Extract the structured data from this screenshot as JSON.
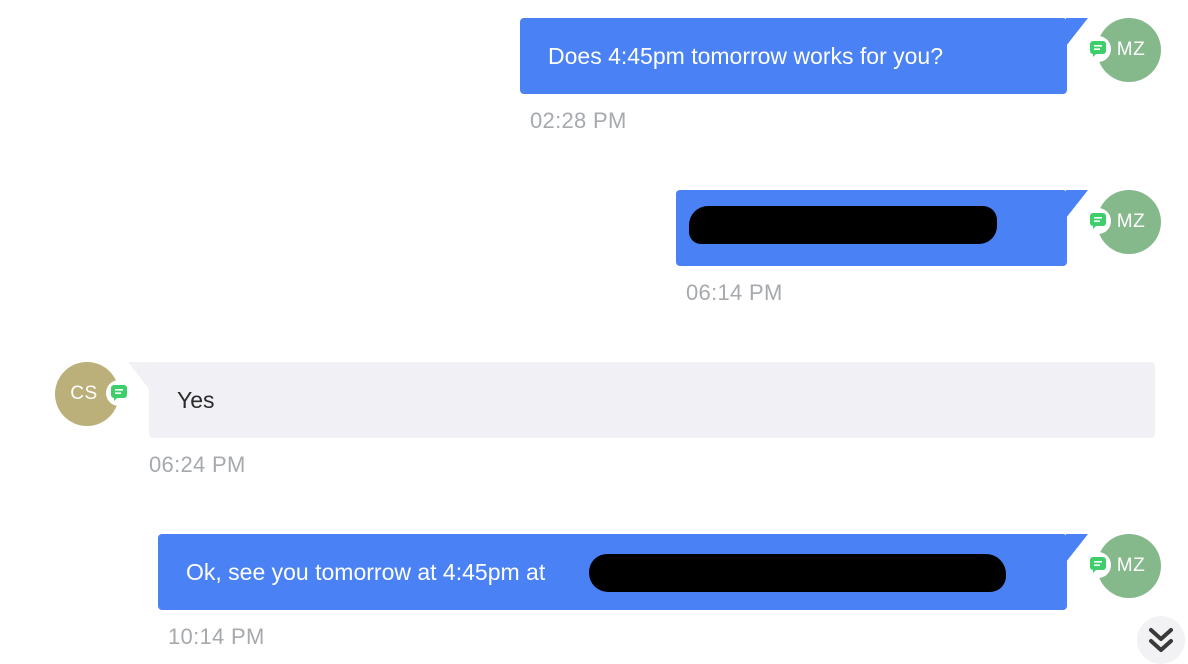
{
  "colors": {
    "outgoing_bubble": "#4a82f5",
    "incoming_bubble": "#f0f0f5",
    "avatar_mz": "#85b98c",
    "avatar_cs": "#bcb07a",
    "sms_channel_icon": "#3ecf6a"
  },
  "messages": [
    {
      "direction": "outgoing",
      "text": "Does 4:45pm tomorrow works for you?",
      "time": "02:28 PM",
      "avatar_initials": "MZ"
    },
    {
      "direction": "outgoing",
      "text": "",
      "redacted": true,
      "time": "06:14 PM",
      "avatar_initials": "MZ"
    },
    {
      "direction": "incoming",
      "text": "Yes",
      "time": "06:24 PM",
      "avatar_initials": "CS"
    },
    {
      "direction": "outgoing",
      "text": "Ok, see you tomorrow at 4:45pm at",
      "redacted_suffix": true,
      "time": "10:14 PM",
      "avatar_initials": "MZ"
    }
  ],
  "scroll_to_bottom_icon": "double-chevron-down-icon"
}
